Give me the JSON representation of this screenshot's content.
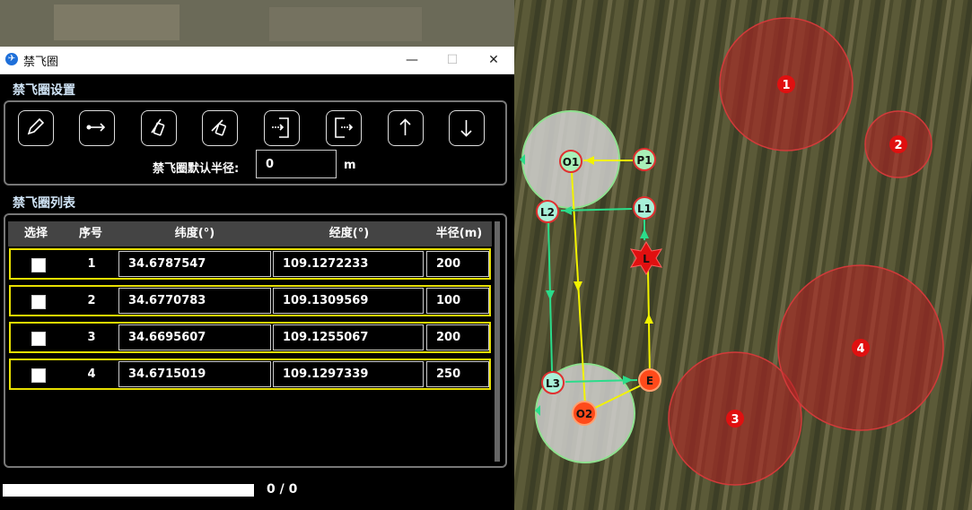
{
  "window": {
    "title": "禁飞圈",
    "minimize_icon": "minimize-icon",
    "maximize_icon": "maximize-icon",
    "close_icon": "close-icon"
  },
  "settings": {
    "section_label": "禁飞圈设置",
    "toolbar": [
      {
        "icon": "pencil-icon"
      },
      {
        "icon": "route-arrow-icon"
      },
      {
        "icon": "eraser-icon"
      },
      {
        "icon": "eraser-alt-icon"
      },
      {
        "icon": "import-icon"
      },
      {
        "icon": "export-icon"
      },
      {
        "icon": "arrow-up-icon"
      },
      {
        "icon": "arrow-down-icon"
      }
    ],
    "radius_label": "禁飞圈默认半径:",
    "radius_value": "0",
    "radius_unit": "m"
  },
  "list": {
    "section_label": "禁飞圈列表",
    "columns": [
      "选择",
      "序号",
      "纬度(°)",
      "经度(°)",
      "半径(m)"
    ],
    "rows": [
      {
        "index": "1",
        "lat": "34.6787547",
        "lon": "109.1272233",
        "radius": "200",
        "checked": false
      },
      {
        "index": "2",
        "lat": "34.6770783",
        "lon": "109.1309569",
        "radius": "100",
        "checked": false
      },
      {
        "index": "3",
        "lat": "34.6695607",
        "lon": "109.1255067",
        "radius": "200",
        "checked": false
      },
      {
        "index": "4",
        "lat": "34.6715019",
        "lon": "109.1297339",
        "radius": "250",
        "checked": false
      }
    ]
  },
  "progress": {
    "value": 0,
    "text": "0 / 0"
  },
  "map": {
    "zones": [
      "1",
      "2",
      "3",
      "4"
    ],
    "waypoints": [
      "O1",
      "P1",
      "L2",
      "L1",
      "L",
      "L3",
      "E",
      "O2"
    ],
    "zone_color": "#cc2a2a",
    "safe_color": "#8fe08f",
    "route_yellow": "#f2f200",
    "route_green": "#2bdc8a"
  }
}
